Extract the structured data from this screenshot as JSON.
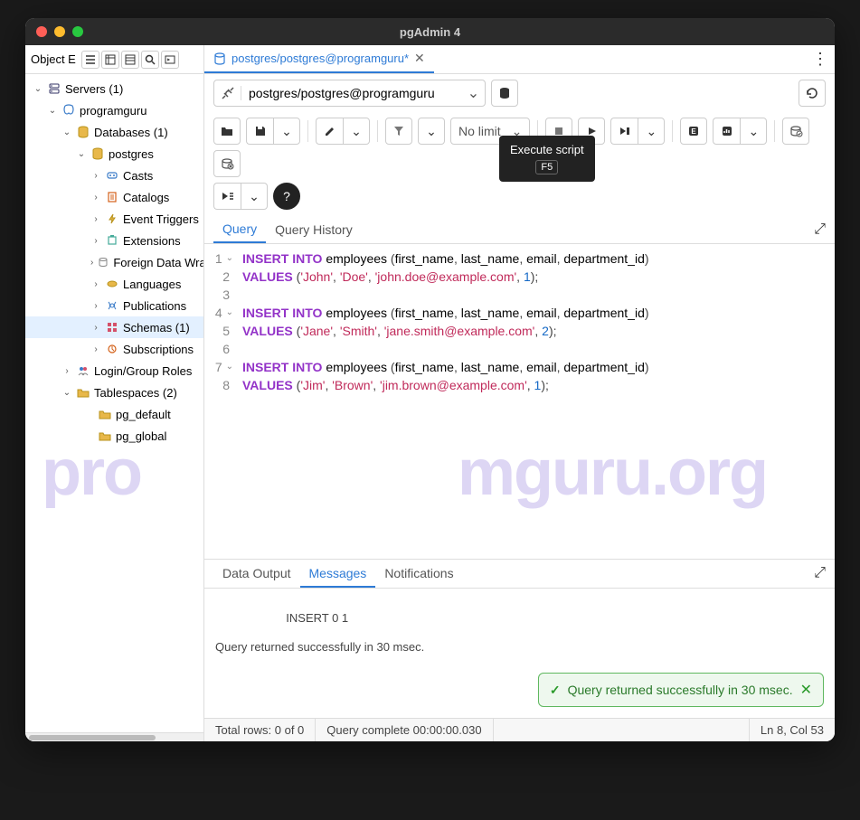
{
  "title": "pgAdmin 4",
  "sidebar_label": "Object E",
  "tree": [
    {
      "indent": 8,
      "arrow": "down",
      "icon": "server",
      "label": "Servers (1)"
    },
    {
      "indent": 24,
      "arrow": "down",
      "icon": "pg",
      "label": "programguru"
    },
    {
      "indent": 40,
      "arrow": "down",
      "icon": "db",
      "label": "Databases (1)"
    },
    {
      "indent": 56,
      "arrow": "down",
      "icon": "db",
      "label": "postgres"
    },
    {
      "indent": 72,
      "arrow": "right",
      "icon": "cast",
      "label": "Casts"
    },
    {
      "indent": 72,
      "arrow": "right",
      "icon": "catalog",
      "label": "Catalogs"
    },
    {
      "indent": 72,
      "arrow": "right",
      "icon": "event",
      "label": "Event Triggers"
    },
    {
      "indent": 72,
      "arrow": "right",
      "icon": "ext",
      "label": "Extensions"
    },
    {
      "indent": 72,
      "arrow": "right",
      "icon": "fdw",
      "label": "Foreign Data Wra"
    },
    {
      "indent": 72,
      "arrow": "right",
      "icon": "lang",
      "label": "Languages"
    },
    {
      "indent": 72,
      "arrow": "right",
      "icon": "pub",
      "label": "Publications"
    },
    {
      "indent": 72,
      "arrow": "right",
      "icon": "schema",
      "label": "Schemas (1)",
      "selected": true
    },
    {
      "indent": 72,
      "arrow": "right",
      "icon": "sub",
      "label": "Subscriptions"
    },
    {
      "indent": 40,
      "arrow": "right",
      "icon": "login",
      "label": "Login/Group Roles"
    },
    {
      "indent": 40,
      "arrow": "down",
      "icon": "ts",
      "label": "Tablespaces (2)"
    },
    {
      "indent": 64,
      "arrow": "",
      "icon": "folder",
      "label": "pg_default"
    },
    {
      "indent": 64,
      "arrow": "",
      "icon": "folder",
      "label": "pg_global"
    }
  ],
  "tab": {
    "label": "postgres/postgres@programguru*"
  },
  "connection": "postgres/postgres@programguru",
  "limit": "No limit",
  "tooltip": {
    "text": "Execute script",
    "key": "F5"
  },
  "editor_tabs": [
    "Query",
    "Query History"
  ],
  "code_lines": [
    {
      "n": 1,
      "fold": true,
      "tokens": [
        [
          "kw",
          "INSERT"
        ],
        [
          "sp",
          " "
        ],
        [
          "kw",
          "INTO"
        ],
        [
          "sp",
          " employees "
        ],
        [
          "punc",
          "("
        ],
        [
          "sp",
          "first_name"
        ],
        [
          "punc",
          ","
        ],
        [
          "sp",
          " last_name"
        ],
        [
          "punc",
          ","
        ],
        [
          "sp",
          " email"
        ],
        [
          "punc",
          ","
        ],
        [
          "sp",
          " department_id"
        ],
        [
          "punc",
          ")"
        ]
      ]
    },
    {
      "n": 2,
      "tokens": [
        [
          "kw",
          "VALUES"
        ],
        [
          "sp",
          " "
        ],
        [
          "punc",
          "("
        ],
        [
          "str",
          "'John'"
        ],
        [
          "punc",
          ","
        ],
        [
          "sp",
          " "
        ],
        [
          "str",
          "'Doe'"
        ],
        [
          "punc",
          ","
        ],
        [
          "sp",
          " "
        ],
        [
          "str",
          "'john.doe@example.com'"
        ],
        [
          "punc",
          ","
        ],
        [
          "sp",
          " "
        ],
        [
          "num",
          "1"
        ],
        [
          "punc",
          ")"
        ],
        [
          "punc",
          ";"
        ]
      ]
    },
    {
      "n": 3,
      "tokens": []
    },
    {
      "n": 4,
      "fold": true,
      "tokens": [
        [
          "kw",
          "INSERT"
        ],
        [
          "sp",
          " "
        ],
        [
          "kw",
          "INTO"
        ],
        [
          "sp",
          " employees "
        ],
        [
          "punc",
          "("
        ],
        [
          "sp",
          "first_name"
        ],
        [
          "punc",
          ","
        ],
        [
          "sp",
          " last_name"
        ],
        [
          "punc",
          ","
        ],
        [
          "sp",
          " email"
        ],
        [
          "punc",
          ","
        ],
        [
          "sp",
          " department_id"
        ],
        [
          "punc",
          ")"
        ]
      ]
    },
    {
      "n": 5,
      "tokens": [
        [
          "kw",
          "VALUES"
        ],
        [
          "sp",
          " "
        ],
        [
          "punc",
          "("
        ],
        [
          "str",
          "'Jane'"
        ],
        [
          "punc",
          ","
        ],
        [
          "sp",
          " "
        ],
        [
          "str",
          "'Smith'"
        ],
        [
          "punc",
          ","
        ],
        [
          "sp",
          " "
        ],
        [
          "str",
          "'jane.smith@example.com'"
        ],
        [
          "punc",
          ","
        ],
        [
          "sp",
          " "
        ],
        [
          "num",
          "2"
        ],
        [
          "punc",
          ")"
        ],
        [
          "punc",
          ";"
        ]
      ]
    },
    {
      "n": 6,
      "tokens": []
    },
    {
      "n": 7,
      "fold": true,
      "tokens": [
        [
          "kw",
          "INSERT"
        ],
        [
          "sp",
          " "
        ],
        [
          "kw",
          "INTO"
        ],
        [
          "sp",
          " employees "
        ],
        [
          "punc",
          "("
        ],
        [
          "sp",
          "first_name"
        ],
        [
          "punc",
          ","
        ],
        [
          "sp",
          " last_name"
        ],
        [
          "punc",
          ","
        ],
        [
          "sp",
          " email"
        ],
        [
          "punc",
          ","
        ],
        [
          "sp",
          " department_id"
        ],
        [
          "punc",
          ")"
        ]
      ]
    },
    {
      "n": 8,
      "tokens": [
        [
          "kw",
          "VALUES"
        ],
        [
          "sp",
          " "
        ],
        [
          "punc",
          "("
        ],
        [
          "str",
          "'Jim'"
        ],
        [
          "punc",
          ","
        ],
        [
          "sp",
          " "
        ],
        [
          "str",
          "'Brown'"
        ],
        [
          "punc",
          ","
        ],
        [
          "sp",
          " "
        ],
        [
          "str",
          "'jim.brown@example.com'"
        ],
        [
          "punc",
          ","
        ],
        [
          "sp",
          " "
        ],
        [
          "num",
          "1"
        ],
        [
          "punc",
          ")"
        ],
        [
          "punc",
          ";"
        ]
      ]
    }
  ],
  "output_tabs": [
    "Data Output",
    "Messages",
    "Notifications"
  ],
  "output_text": "INSERT 0 1\n\nQuery returned successfully in 30 msec.",
  "toast": "Query returned successfully in 30 msec.",
  "status": {
    "rows": "Total rows: 0 of 0",
    "time": "Query complete 00:00:00.030",
    "cursor": "Ln 8, Col 53"
  },
  "watermark1": "pro",
  "watermark2": "mguru.org"
}
